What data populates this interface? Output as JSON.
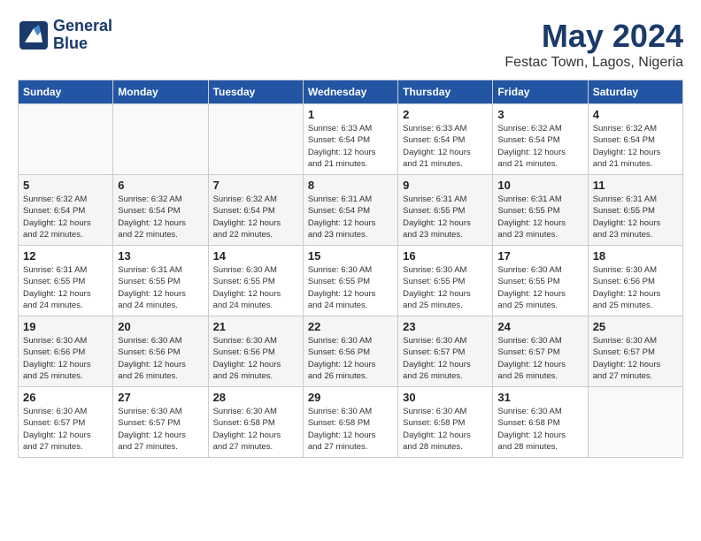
{
  "header": {
    "logo_line1": "General",
    "logo_line2": "Blue",
    "month": "May 2024",
    "location": "Festac Town, Lagos, Nigeria"
  },
  "days_of_week": [
    "Sunday",
    "Monday",
    "Tuesday",
    "Wednesday",
    "Thursday",
    "Friday",
    "Saturday"
  ],
  "weeks": [
    [
      {
        "num": "",
        "info": ""
      },
      {
        "num": "",
        "info": ""
      },
      {
        "num": "",
        "info": ""
      },
      {
        "num": "1",
        "info": "Sunrise: 6:33 AM\nSunset: 6:54 PM\nDaylight: 12 hours\nand 21 minutes."
      },
      {
        "num": "2",
        "info": "Sunrise: 6:33 AM\nSunset: 6:54 PM\nDaylight: 12 hours\nand 21 minutes."
      },
      {
        "num": "3",
        "info": "Sunrise: 6:32 AM\nSunset: 6:54 PM\nDaylight: 12 hours\nand 21 minutes."
      },
      {
        "num": "4",
        "info": "Sunrise: 6:32 AM\nSunset: 6:54 PM\nDaylight: 12 hours\nand 21 minutes."
      }
    ],
    [
      {
        "num": "5",
        "info": "Sunrise: 6:32 AM\nSunset: 6:54 PM\nDaylight: 12 hours\nand 22 minutes."
      },
      {
        "num": "6",
        "info": "Sunrise: 6:32 AM\nSunset: 6:54 PM\nDaylight: 12 hours\nand 22 minutes."
      },
      {
        "num": "7",
        "info": "Sunrise: 6:32 AM\nSunset: 6:54 PM\nDaylight: 12 hours\nand 22 minutes."
      },
      {
        "num": "8",
        "info": "Sunrise: 6:31 AM\nSunset: 6:54 PM\nDaylight: 12 hours\nand 23 minutes."
      },
      {
        "num": "9",
        "info": "Sunrise: 6:31 AM\nSunset: 6:55 PM\nDaylight: 12 hours\nand 23 minutes."
      },
      {
        "num": "10",
        "info": "Sunrise: 6:31 AM\nSunset: 6:55 PM\nDaylight: 12 hours\nand 23 minutes."
      },
      {
        "num": "11",
        "info": "Sunrise: 6:31 AM\nSunset: 6:55 PM\nDaylight: 12 hours\nand 23 minutes."
      }
    ],
    [
      {
        "num": "12",
        "info": "Sunrise: 6:31 AM\nSunset: 6:55 PM\nDaylight: 12 hours\nand 24 minutes."
      },
      {
        "num": "13",
        "info": "Sunrise: 6:31 AM\nSunset: 6:55 PM\nDaylight: 12 hours\nand 24 minutes."
      },
      {
        "num": "14",
        "info": "Sunrise: 6:30 AM\nSunset: 6:55 PM\nDaylight: 12 hours\nand 24 minutes."
      },
      {
        "num": "15",
        "info": "Sunrise: 6:30 AM\nSunset: 6:55 PM\nDaylight: 12 hours\nand 24 minutes."
      },
      {
        "num": "16",
        "info": "Sunrise: 6:30 AM\nSunset: 6:55 PM\nDaylight: 12 hours\nand 25 minutes."
      },
      {
        "num": "17",
        "info": "Sunrise: 6:30 AM\nSunset: 6:55 PM\nDaylight: 12 hours\nand 25 minutes."
      },
      {
        "num": "18",
        "info": "Sunrise: 6:30 AM\nSunset: 6:56 PM\nDaylight: 12 hours\nand 25 minutes."
      }
    ],
    [
      {
        "num": "19",
        "info": "Sunrise: 6:30 AM\nSunset: 6:56 PM\nDaylight: 12 hours\nand 25 minutes."
      },
      {
        "num": "20",
        "info": "Sunrise: 6:30 AM\nSunset: 6:56 PM\nDaylight: 12 hours\nand 26 minutes."
      },
      {
        "num": "21",
        "info": "Sunrise: 6:30 AM\nSunset: 6:56 PM\nDaylight: 12 hours\nand 26 minutes."
      },
      {
        "num": "22",
        "info": "Sunrise: 6:30 AM\nSunset: 6:56 PM\nDaylight: 12 hours\nand 26 minutes."
      },
      {
        "num": "23",
        "info": "Sunrise: 6:30 AM\nSunset: 6:57 PM\nDaylight: 12 hours\nand 26 minutes."
      },
      {
        "num": "24",
        "info": "Sunrise: 6:30 AM\nSunset: 6:57 PM\nDaylight: 12 hours\nand 26 minutes."
      },
      {
        "num": "25",
        "info": "Sunrise: 6:30 AM\nSunset: 6:57 PM\nDaylight: 12 hours\nand 27 minutes."
      }
    ],
    [
      {
        "num": "26",
        "info": "Sunrise: 6:30 AM\nSunset: 6:57 PM\nDaylight: 12 hours\nand 27 minutes."
      },
      {
        "num": "27",
        "info": "Sunrise: 6:30 AM\nSunset: 6:57 PM\nDaylight: 12 hours\nand 27 minutes."
      },
      {
        "num": "28",
        "info": "Sunrise: 6:30 AM\nSunset: 6:58 PM\nDaylight: 12 hours\nand 27 minutes."
      },
      {
        "num": "29",
        "info": "Sunrise: 6:30 AM\nSunset: 6:58 PM\nDaylight: 12 hours\nand 27 minutes."
      },
      {
        "num": "30",
        "info": "Sunrise: 6:30 AM\nSunset: 6:58 PM\nDaylight: 12 hours\nand 28 minutes."
      },
      {
        "num": "31",
        "info": "Sunrise: 6:30 AM\nSunset: 6:58 PM\nDaylight: 12 hours\nand 28 minutes."
      },
      {
        "num": "",
        "info": ""
      }
    ]
  ]
}
